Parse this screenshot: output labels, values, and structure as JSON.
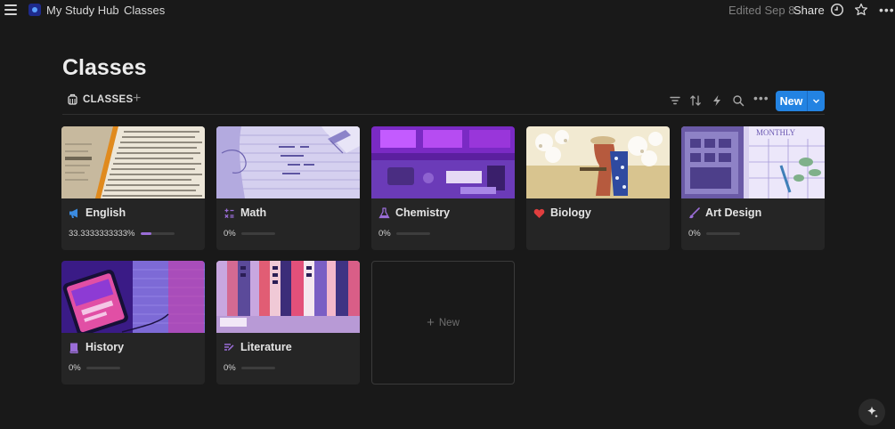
{
  "breadcrumb": {
    "workspace": "My Study Hub",
    "separator": "/",
    "page": "Classes"
  },
  "topbar": {
    "edited": "Edited Sep 8",
    "share": "Share"
  },
  "page": {
    "title": "Classes"
  },
  "view": {
    "tab_label": "CLASSES",
    "new_button": "New"
  },
  "cards": [
    {
      "title": "English",
      "progress_label": "33.3333333333%",
      "progress": 0.3333,
      "icon": "megaphone-icon",
      "icon_color": "#3b8be0"
    },
    {
      "title": "Math",
      "progress_label": "0%",
      "progress": 0,
      "icon": "calculator-icon",
      "icon_color": "#9a6dd7"
    },
    {
      "title": "Chemistry",
      "progress_label": "0%",
      "progress": 0,
      "icon": "flask-icon",
      "icon_color": "#9a6dd7"
    },
    {
      "title": "Biology",
      "icon": "heart-icon",
      "icon_color": "#e03e3e"
    },
    {
      "title": "Art Design",
      "progress_label": "0%",
      "progress": 0,
      "icon": "brush-icon",
      "icon_color": "#9a6dd7"
    },
    {
      "title": "History",
      "progress_label": "0%",
      "progress": 0,
      "icon": "book-icon",
      "icon_color": "#9a6dd7"
    },
    {
      "title": "Literature",
      "progress_label": "0%",
      "progress": 0,
      "icon": "text-edit-icon",
      "icon_color": "#9a6dd7"
    }
  ],
  "new_card": {
    "label": "New"
  }
}
